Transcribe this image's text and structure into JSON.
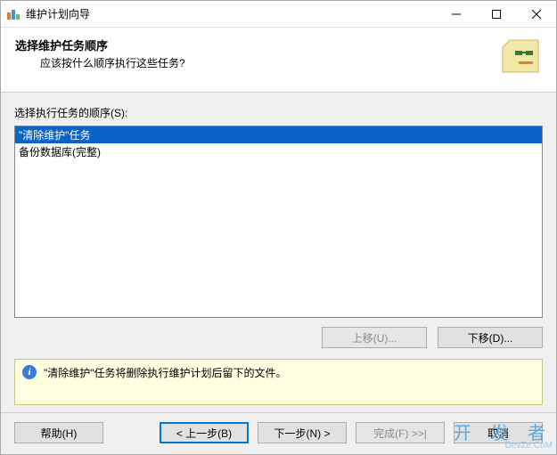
{
  "window": {
    "title": "维护计划向导"
  },
  "header": {
    "title": "选择维护任务顺序",
    "subtitle": "应该按什么顺序执行这些任务?"
  },
  "body": {
    "list_label": "选择执行任务的顺序(S):",
    "items": [
      {
        "label": "\"清除维护\"任务",
        "selected": true
      },
      {
        "label": "备份数据库(完整)",
        "selected": false
      }
    ],
    "move_up": "上移(U)...",
    "move_down": "下移(D)...",
    "info": "\"清除维护\"任务将删除执行维护计划后留下的文件。"
  },
  "footer": {
    "help": "帮助(H)",
    "back": "< 上一步(B)",
    "next": "下一步(N) >",
    "finish": "完成(F) >>|",
    "cancel": "取消"
  },
  "watermark": {
    "main": "开 发 者",
    "sub": "DevZe.CoM"
  }
}
